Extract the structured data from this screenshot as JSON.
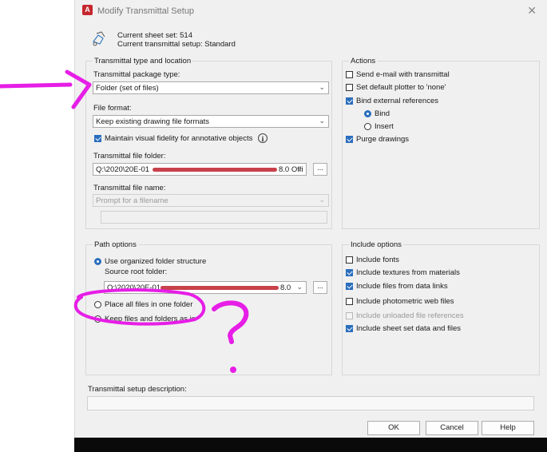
{
  "window": {
    "title": "Modify Transmittal Setup",
    "close": "✕",
    "app_letter": "A"
  },
  "header": {
    "sheet_set": "Current sheet set: 514",
    "setup": "Current transmittal setup: Standard"
  },
  "type_location": {
    "group_label": "Transmittal type and location",
    "package_type_label": "Transmittal package type:",
    "package_type_value": "Folder (set of files)",
    "file_format_label": "File format:",
    "file_format_value": "Keep existing drawing file formats",
    "maintain_fidelity_label": "Maintain visual fidelity for annotative objects",
    "maintain_fidelity_checked": true,
    "info_glyph": "i",
    "folder_label": "Transmittal file folder:",
    "folder_value_start": "Q:\\2020\\20E-01",
    "folder_value_end": "8.0 Offi",
    "browse_label": "...",
    "file_name_label": "Transmittal file name:",
    "file_name_value": "Prompt for a filename"
  },
  "actions": {
    "group_label": "Actions",
    "items": [
      {
        "label": "Send e-mail with transmittal",
        "checked": false
      },
      {
        "label": "Set default plotter to 'none'",
        "checked": false
      },
      {
        "label": "Bind external references",
        "checked": true
      },
      {
        "label": "Purge drawings",
        "checked": true
      }
    ],
    "bind_radio": "Bind",
    "insert_radio": "Insert",
    "bind_selected": "Bind"
  },
  "path_options": {
    "group_label": "Path options",
    "organized_label": "Use organized folder structure",
    "source_root_label": "Source root folder:",
    "source_root_start": "Q:\\2020\\20E-01",
    "source_root_end": "8.0",
    "browse_label": "...",
    "place_all_label": "Place all files in one folder",
    "keep_label": "Keep files and folders as is",
    "selected": "Use organized folder structure"
  },
  "include_options": {
    "group_label": "Include options",
    "items": [
      {
        "label": "Include fonts",
        "checked": false,
        "enabled": true
      },
      {
        "label": "Include textures from materials",
        "checked": true,
        "enabled": true
      },
      {
        "label": "Include files from data links",
        "checked": true,
        "enabled": true
      },
      {
        "label": "Include photometric web files",
        "checked": false,
        "enabled": true
      },
      {
        "label": "Include unloaded file references",
        "checked": false,
        "enabled": false
      },
      {
        "label": "Include sheet set data and files",
        "checked": true,
        "enabled": true
      }
    ]
  },
  "description": {
    "label": "Transmittal setup description:",
    "value": ""
  },
  "buttons": {
    "ok": "OK",
    "cancel": "Cancel",
    "help": "Help"
  },
  "annotation": {
    "text": "?",
    "color": "#e61ee6"
  },
  "colors": {
    "accent": "#2a6ebd",
    "redaction": "#c8414b",
    "annotation": "#e61ee6"
  }
}
